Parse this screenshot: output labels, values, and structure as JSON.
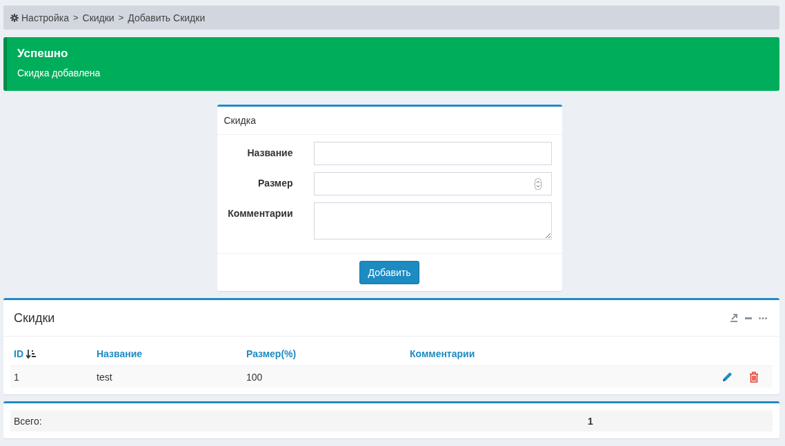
{
  "breadcrumb": [
    {
      "kind": "crumb",
      "text": "Настройка"
    },
    {
      "kind": "separator",
      "text": ">"
    },
    {
      "kind": "crumb",
      "text": "Скидки"
    },
    {
      "kind": "separator",
      "text": ">"
    },
    {
      "kind": "crumb",
      "text": "Добавить Скидки"
    }
  ],
  "alert": {
    "kind": "success",
    "title": "Успешно",
    "message": "Скидка добавлена"
  },
  "form": {
    "title": "Скидка",
    "fields": [
      {
        "label": "Название",
        "kind": "text"
      },
      {
        "label": "Размер",
        "kind": "number"
      },
      {
        "label": "Комментарии",
        "kind": "textarea"
      }
    ],
    "submit": "Добавить"
  },
  "table": {
    "title": "Скидки",
    "columns": [
      {
        "label": "ID",
        "sorted": true
      },
      {
        "label": "Название",
        "sorted": false
      },
      {
        "label": "Размер(%)",
        "sorted": false
      },
      {
        "label": "Комментарии",
        "sorted": false
      }
    ],
    "rows": [
      {
        "cells": [
          "1",
          "test",
          "100"
        ]
      }
    ]
  },
  "totals": {
    "label": "Всего:",
    "value": "1"
  }
}
